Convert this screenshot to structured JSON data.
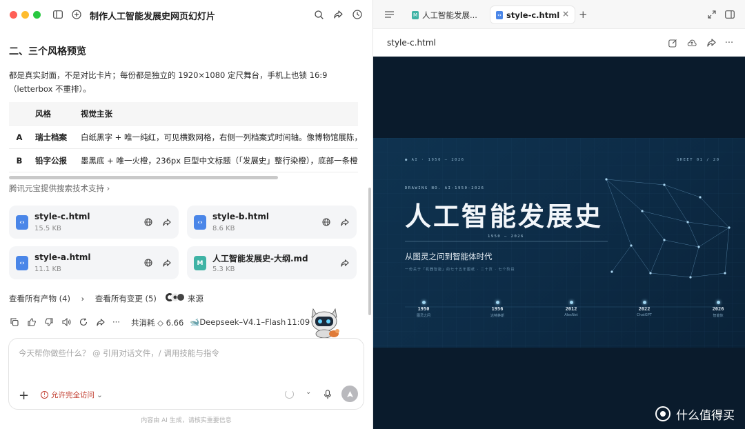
{
  "window": {
    "title": "制作人工智能发展史网页幻灯片"
  },
  "content": {
    "section_heading": "二、三个风格预览",
    "paragraph": "都是真实封面，不是对比卡片；每份都是独立的 1920×1080 定尺舞台，手机上也锁 16:9（letterbox 不重排）。",
    "table": {
      "headers": [
        "",
        "风格",
        "视觉主张"
      ],
      "rows": [
        [
          "A",
          "瑞士档案",
          "白纸黑字 + 唯一纯红，可见横数网格，右侧一列档案式时间轴。像博物馆展陈，"
        ],
        [
          "B",
          "铅字公报",
          "墨黑底 + 唯一火橙，236px 巨型中文标题（「发展史」整行染橙），底部一条橙"
        ]
      ]
    },
    "search_note": "腾讯元宝提供搜索技术支持",
    "files": [
      {
        "name": "style-c.html",
        "size": "15.5 KB",
        "type": "html"
      },
      {
        "name": "style-b.html",
        "size": "8.6 KB",
        "type": "html"
      },
      {
        "name": "style-a.html",
        "size": "11.1 KB",
        "type": "html"
      },
      {
        "name": "人工智能发展史-大纲.md",
        "size": "5.3 KB",
        "type": "md"
      }
    ],
    "links": {
      "all_artifacts": "查看所有产物 (4)",
      "all_changes": "查看所有变更 (5)",
      "source": "来源"
    },
    "meta": {
      "consumption": "共消耗 ◇ 6.66",
      "model": "Deepseek–V4.1–Flash",
      "time": "11:09"
    }
  },
  "composer": {
    "placeholder": "今天帮你做些什么？ @ 引用对话文件，/ 调用技能与指令",
    "permission": "允许完全访问",
    "footer": "内容由 AI 生成，请核实重要信息"
  },
  "preview": {
    "tabs": [
      {
        "label": "人工智能发展...",
        "active": false
      },
      {
        "label": "style-c.html",
        "active": true
      }
    ],
    "filename": "style-c.html",
    "slide": {
      "top_left": "● AI · 1950 — 2026",
      "top_right": "SHEET 01 / 20",
      "drawing_no": "DRAWING NO. AI-1950-2026",
      "title": "人工智能发展史",
      "range": "1950 — 2026",
      "subtitle": "从图灵之问到智能体时代",
      "tiny_line": "一份关于「机器智能」的七十五年图纸 · 二十页 · 七个阶段",
      "timeline": [
        {
          "year": "1950",
          "label": "图灵之问"
        },
        {
          "year": "1956",
          "label": "达特茅斯"
        },
        {
          "year": "2012",
          "label": "AlexNet"
        },
        {
          "year": "2022",
          "label": "ChatGPT"
        },
        {
          "year": "2026",
          "label": "智能体"
        }
      ]
    }
  },
  "watermark": "什么值得买",
  "colors": {
    "accent_blue": "#4a86e8",
    "md_teal": "#3fb3a5",
    "permission_red": "#c0392b",
    "slide_bg": "#0f3350"
  }
}
